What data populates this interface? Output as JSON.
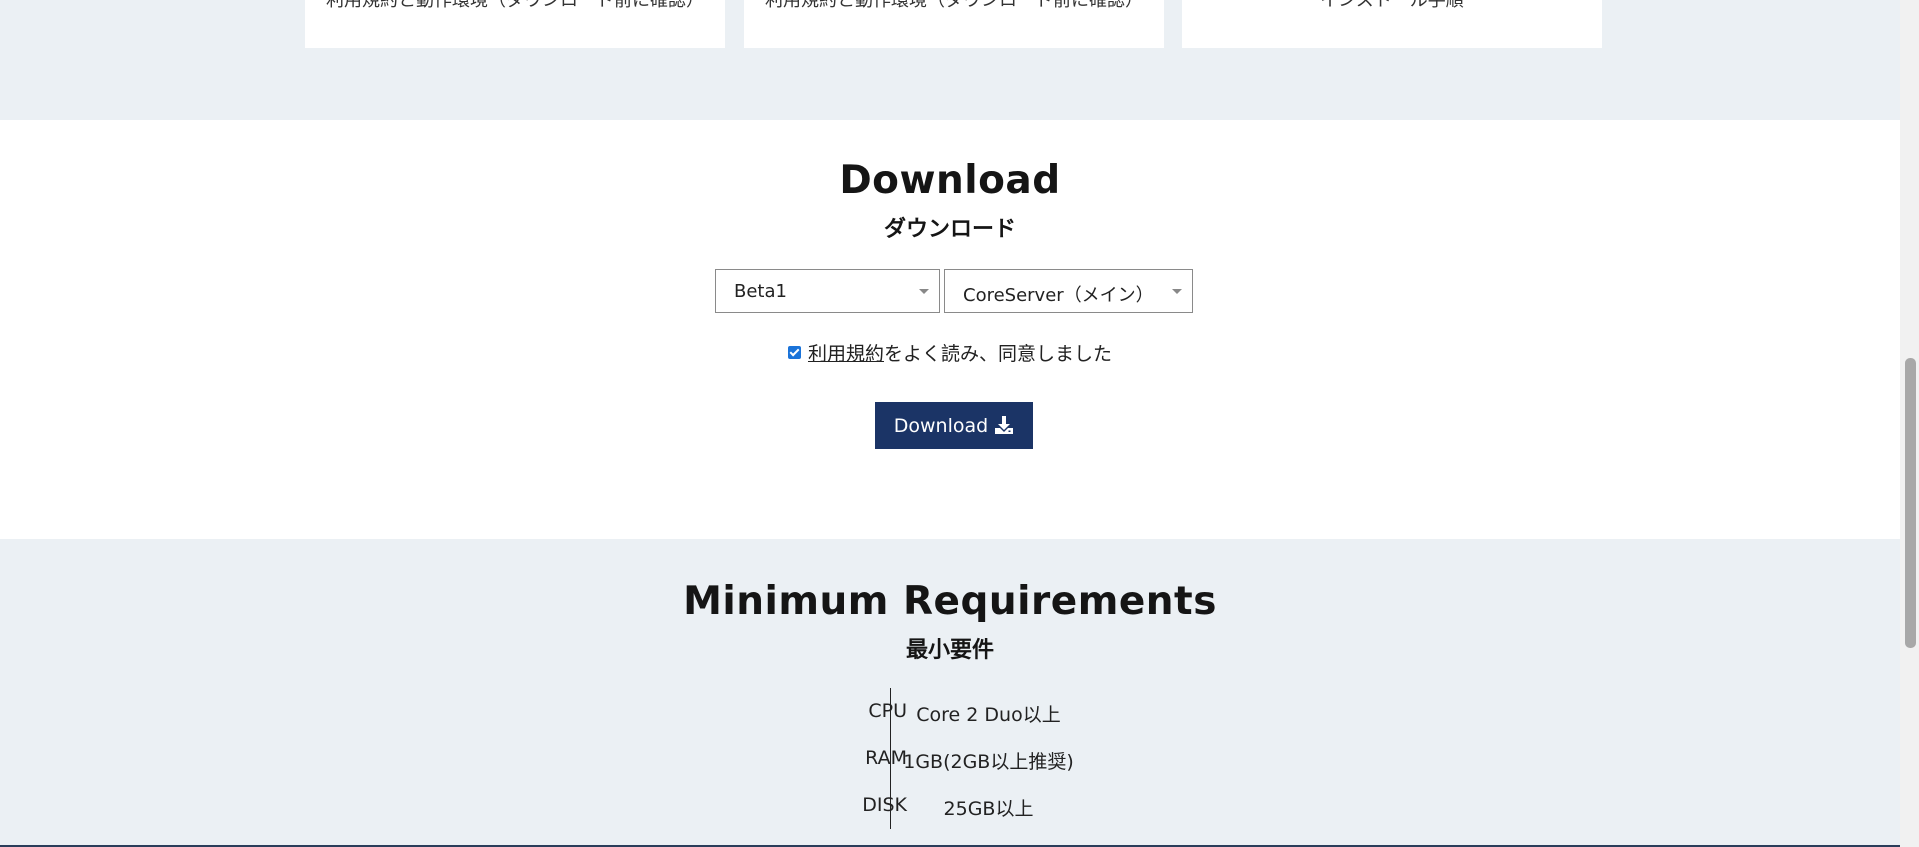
{
  "top_cards": [
    {
      "text": "利用規約と動作環境（ダウンロード前に確認）"
    },
    {
      "text": "利用規約と動作環境（ダウンロード前に確認）"
    },
    {
      "text": "インストール手順"
    }
  ],
  "download": {
    "title": "Download",
    "subtitle": "ダウンロード",
    "version_select": "Beta1",
    "edition_select": "CoreServer（メイン）",
    "agree_checked": true,
    "terms_link": "利用規約",
    "agree_text": "をよく読み、同意しました",
    "button_label": "Download"
  },
  "requirements": {
    "title": "Minimum Requirements",
    "subtitle": "最小要件",
    "rows": [
      {
        "key": "CPU",
        "value": "Core 2 Duo以上"
      },
      {
        "key": "RAM",
        "value": "1GB(2GB以上推奨)"
      },
      {
        "key": "DISK",
        "value": "25GB以上"
      }
    ]
  },
  "colors": {
    "band_bg": "#ebf0f4",
    "button_bg": "#1b3466",
    "checkbox": "#1a73d9"
  }
}
